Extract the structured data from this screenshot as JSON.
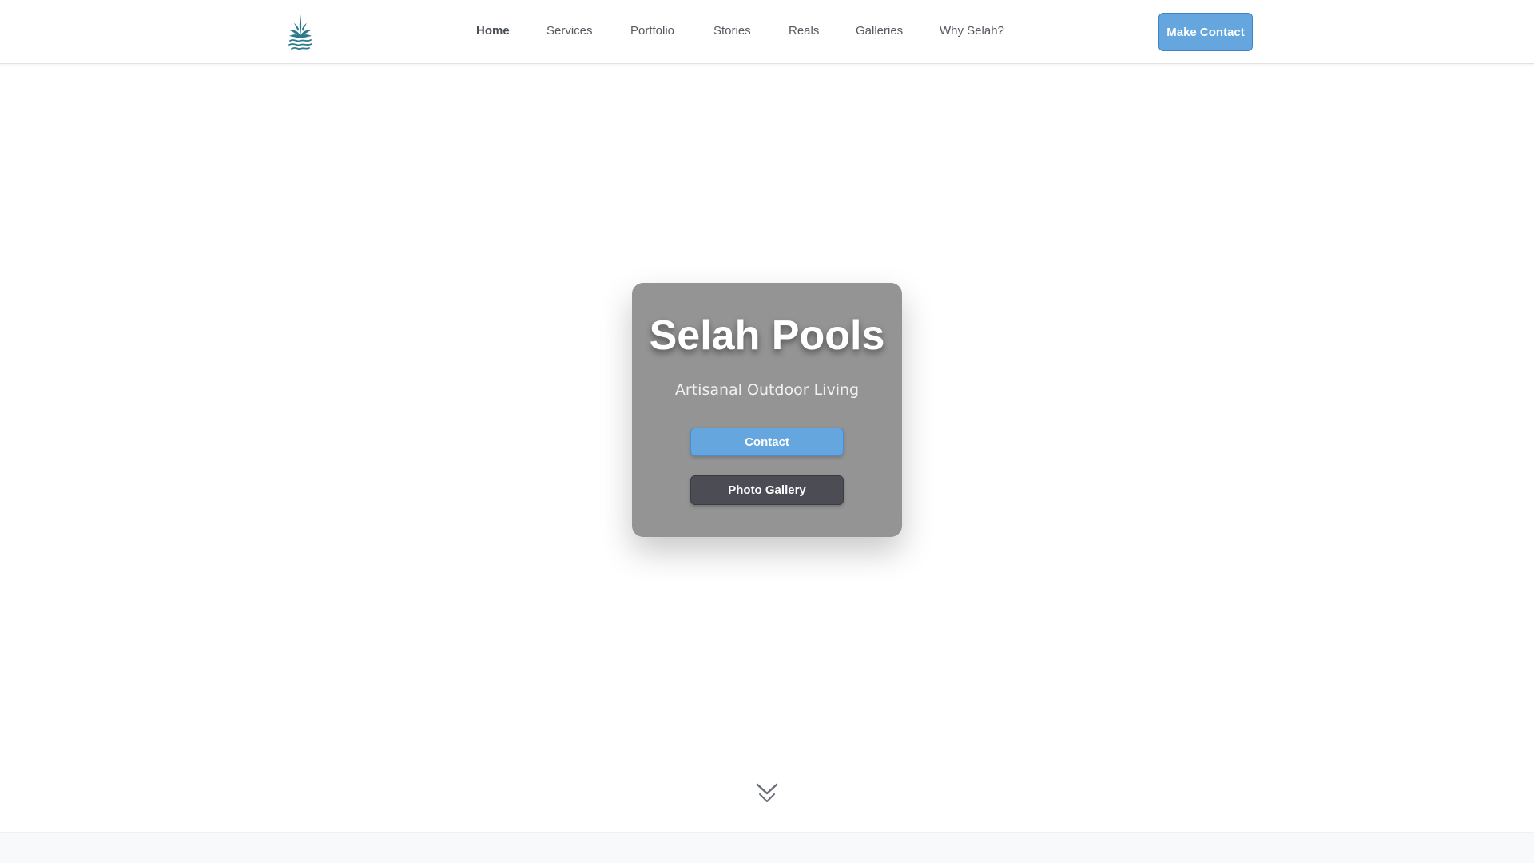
{
  "brand": {
    "logo_icon": "lotus-wave-logo-icon",
    "logo_color": "#2a7a8c"
  },
  "nav": {
    "items": [
      {
        "label": "Home",
        "active": true
      },
      {
        "label": "Services",
        "active": false
      },
      {
        "label": "Portfolio",
        "active": false
      },
      {
        "label": "Stories",
        "active": false
      },
      {
        "label": "Reals",
        "active": false
      },
      {
        "label": "Galleries",
        "active": false
      },
      {
        "label": "Why Selah?",
        "active": false
      }
    ],
    "cta_label": "Make Contact"
  },
  "hero": {
    "title": "Selah Pools",
    "subtitle": "Artisanal Outdoor Living",
    "contact_label": "Contact",
    "gallery_label": "Photo Gallery"
  },
  "scroll": {
    "icon": "double-chevron-down-icon"
  },
  "colors": {
    "accent": "#64a6dd",
    "card": "#949494",
    "dark_button": "#4c4c54",
    "nav_text": "#555a60"
  }
}
